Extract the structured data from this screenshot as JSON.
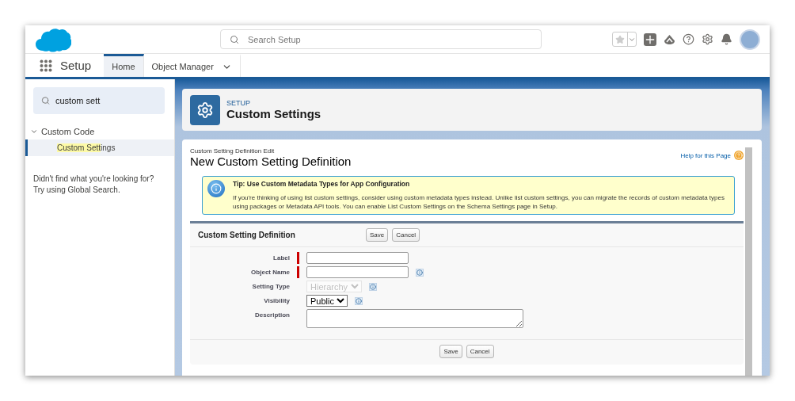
{
  "header": {
    "search": {
      "placeholder": "Search Setup"
    },
    "favorite": {
      "on": false
    }
  },
  "nav": {
    "app_name": "Setup",
    "tabs": [
      {
        "label": "Home",
        "selected": true,
        "has_menu": false
      },
      {
        "label": "Object Manager",
        "selected": false,
        "has_menu": true
      }
    ]
  },
  "sidebar": {
    "search": {
      "value": "custom sett"
    },
    "tree": [
      {
        "label": "Custom Code",
        "expanded": true,
        "children": [
          {
            "label_match": "Custom Sett",
            "label_rest": "ings",
            "selected": true
          }
        ]
      }
    ],
    "note_lines": [
      "Didn't find what you're looking for?",
      "Try using Global Search."
    ]
  },
  "page_header": {
    "eyebrow": "SETUP",
    "title": "Custom Settings"
  },
  "content": {
    "breadcrumb": "Custom Setting Definition Edit",
    "title": "New Custom Setting Definition",
    "help_link": "Help for this Page",
    "tip": {
      "title": "Tip: Use Custom Metadata Types for App Configuration",
      "body": "If you're thinking of using list custom settings, consider using custom metadata types instead. Unlike list custom settings, you can migrate the records of custom metadata types using packages or Metadata API tools. You can enable List Custom Settings on the Schema Settings page in Setup."
    },
    "form": {
      "title": "Custom Setting Definition",
      "top_buttons": [
        "Save",
        "Cancel"
      ],
      "fields": [
        {
          "label": "Label",
          "kind": "text",
          "required": true,
          "info": false
        },
        {
          "label": "Object Name",
          "kind": "text",
          "required": true,
          "info": true
        },
        {
          "label": "Setting Type",
          "kind": "select",
          "value": "Hierarchy",
          "disabled": true,
          "required": false,
          "info": true
        },
        {
          "label": "Visibility",
          "kind": "select",
          "value": "Public",
          "disabled": false,
          "required": false,
          "info": true
        },
        {
          "label": "Description",
          "kind": "textarea",
          "required": false,
          "info": false
        }
      ],
      "bottom_buttons": [
        "Save",
        "Cancel"
      ]
    }
  }
}
